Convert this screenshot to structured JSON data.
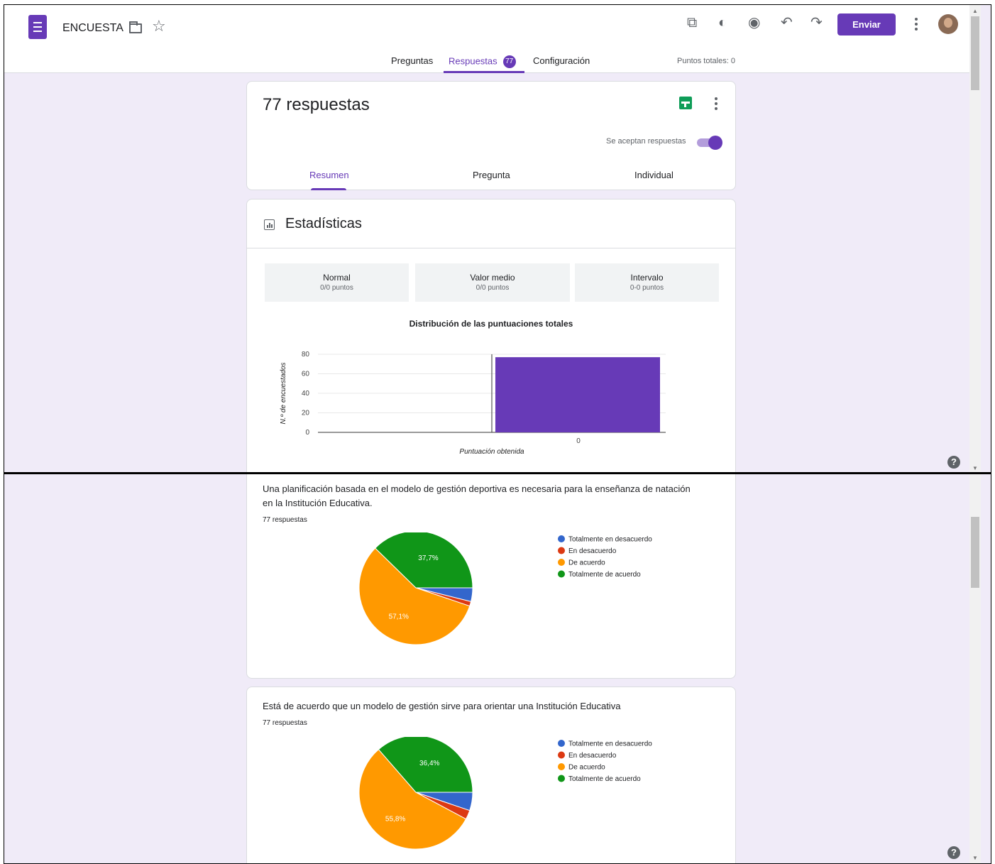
{
  "header": {
    "doc_title": "ENCUESTA",
    "send_label": "Enviar",
    "tabs": [
      {
        "label": "Preguntas"
      },
      {
        "label": "Respuestas",
        "badge": "77"
      },
      {
        "label": "Configuración"
      }
    ],
    "total_points": "Puntos totales: 0",
    "icons": [
      "forms-logo-icon",
      "folder-icon",
      "star-icon",
      "addon-icon",
      "palette-icon",
      "preview-icon",
      "undo-icon",
      "redo-icon",
      "more-icon",
      "avatar"
    ]
  },
  "summary": {
    "title": "77 respuestas",
    "accepting_label": "Se aceptan respuestas",
    "accepting": true,
    "tabs": [
      {
        "label": "Resumen"
      },
      {
        "label": "Pregunta"
      },
      {
        "label": "Individual"
      }
    ]
  },
  "stats": {
    "title": "Estadísticas",
    "boxes": [
      {
        "label": "Normal",
        "value": "0/0 puntos"
      },
      {
        "label": "Valor medio",
        "value": "0/0 puntos"
      },
      {
        "label": "Intervalo",
        "value": "0-0 puntos"
      }
    ]
  },
  "chart_data": [
    {
      "type": "bar",
      "title": "Distribución de las puntuaciones totales",
      "xlabel": "Puntuación obtenida",
      "ylabel": "N.º de encuestados",
      "categories": [
        "0"
      ],
      "values": [
        77
      ],
      "ylim": [
        0,
        80
      ],
      "yticks": [
        "80",
        "60",
        "40",
        "20",
        "0"
      ],
      "color": "#673ab7"
    },
    {
      "type": "pie",
      "labels": [
        "Totalmente en desacuerdo",
        "En desacuerdo",
        "De acuerdo",
        "Totalmente de acuerdo"
      ],
      "values": [
        3.9,
        1.3,
        57.1,
        37.7
      ],
      "display_labels": [
        "",
        "",
        "57,1%",
        "37,7%"
      ],
      "colors": [
        "#3366cc",
        "#dc3912",
        "#ff9900",
        "#109618"
      ]
    },
    {
      "type": "pie",
      "labels": [
        "Totalmente en desacuerdo",
        "En desacuerdo",
        "De acuerdo",
        "Totalmente de acuerdo"
      ],
      "values": [
        5.2,
        2.6,
        55.8,
        36.4
      ],
      "display_labels": [
        "",
        "",
        "55,8%",
        "36,4%"
      ],
      "colors": [
        "#3366cc",
        "#dc3912",
        "#ff9900",
        "#109618"
      ]
    }
  ],
  "questions": [
    {
      "text": "Una planificación basada en el modelo de gestión deportiva es necesaria para la enseñanza de natación en la Institución Educativa.",
      "count": "77 respuestas"
    },
    {
      "text": "Está de acuerdo que un modelo de gestión sirve para orientar una Institución Educativa",
      "count": "77 respuestas"
    }
  ],
  "help_label": "?"
}
